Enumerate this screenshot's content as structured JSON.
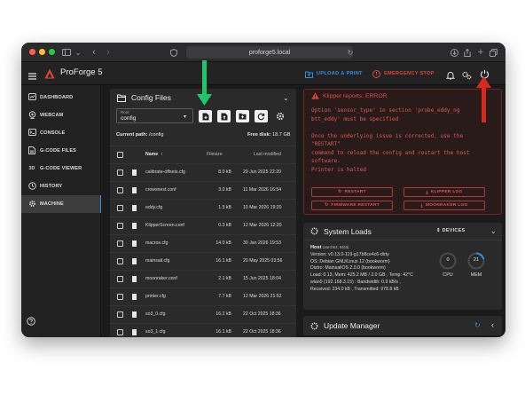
{
  "browser": {
    "url": "proforge5.local"
  },
  "appbar": {
    "title": "ProForge 5",
    "upload_label": "UPLOAD & PRINT",
    "emergency_label": "EMERGENCY STOP"
  },
  "sidebar": {
    "items": [
      {
        "label": "DASHBOARD",
        "icon": "dashboard-icon"
      },
      {
        "label": "WEBCAM",
        "icon": "webcam-icon"
      },
      {
        "label": "CONSOLE",
        "icon": "console-icon"
      },
      {
        "label": "G-CODE FILES",
        "icon": "gcode-files-icon"
      },
      {
        "label": "G-CODE VIEWER",
        "icon": "gcode-viewer-icon",
        "prefix": "3D"
      },
      {
        "label": "HISTORY",
        "icon": "history-icon"
      },
      {
        "label": "MACHINE",
        "icon": "machine-icon",
        "active": true
      }
    ],
    "help_icon": "help-icon"
  },
  "config_files": {
    "title": "Config Files",
    "root_label": "Root",
    "root_value": "config",
    "current_path_label": "Current path:",
    "current_path": "/config",
    "free_disk_label": "Free disk:",
    "free_disk": "18.7 GB",
    "columns": {
      "name": "Name",
      "filesize": "Filesize",
      "modified": "Last modified"
    },
    "files": [
      {
        "name": "calibrate-offsets.cfg",
        "size": "8.0 kB",
        "modified": "29 Jun 2025 22:20"
      },
      {
        "name": "crowsnest.conf",
        "size": "3.0 kB",
        "modified": "11 Mar 2026 16:54"
      },
      {
        "name": "eddy.cfg",
        "size": "1.5 kB",
        "modified": "10 Mar 2026 19:20"
      },
      {
        "name": "KlipperScreen.conf",
        "size": "0.3 kB",
        "modified": "12 Mar 2026 12:20"
      },
      {
        "name": "macros.cfg",
        "size": "14.0 kB",
        "modified": "30 Jan 2026 19:53"
      },
      {
        "name": "mainsail.cfg",
        "size": "16.1 kB",
        "modified": "20 May 2025 03:56"
      },
      {
        "name": "moonraker.conf",
        "size": "2.1 kB",
        "modified": "15 Jun 2025 18:04"
      },
      {
        "name": "printer.cfg",
        "size": "7.7 kB",
        "modified": "12 Mar 2026 21:52"
      },
      {
        "name": "so3_0.cfg",
        "size": "16.2 kB",
        "modified": "22 Oct 2025 18:36"
      },
      {
        "name": "so3_1.cfg",
        "size": "16.1 kB",
        "modified": "22 Oct 2025 18:36"
      }
    ]
  },
  "error": {
    "title": "Klipper reports: ERROR",
    "message": "Option 'sensor_type' in section 'probe_eddy_ng\nbtt_eddy' must be specified\n\nOnce the underlying issue is corrected, use the\n\"RESTART\"\ncommand to reload the config and restart the host\nsoftware.\nPrinter is halted",
    "buttons": {
      "restart": "RESTART",
      "klipper_log": "KLIPPER LOG",
      "firmware_restart": "FIRMWARE RESTART",
      "moonraker_log": "MOONRAKER LOG"
    }
  },
  "system_loads": {
    "title": "System Loads",
    "devices_label": "DEVICES",
    "host_label": "Host",
    "host_arch": "(aarch64, 64bit)",
    "lines": [
      "Version: v0.13.0-119-g17b8ce4c6-dirty",
      "OS: Debian GNU/Linux 12 (bookworm)",
      "Distro: MainsailOS 2.0.0 (bookworm)",
      "Load: 0.13, Mem: 425.2 MB / 2.0 GB , Temp: 42°C",
      "wlan0 (192.168.3.15) : Bandwidth: 0.9 kB/s ,",
      "Received: 234.0 kB , Transmitted: 978.8 kB"
    ],
    "cpu_value": "0",
    "cpu_label": "CPU",
    "mem_value": "21",
    "mem_percent": 21,
    "mem_label": "MEM"
  },
  "update_manager": {
    "title": "Update Manager"
  },
  "colors": {
    "accent_blue": "#2f8fe6",
    "emergency_red": "#e0453a",
    "error_red": "#d64040",
    "annotation_green": "#1fc46b",
    "annotation_red": "#d62a1e"
  }
}
